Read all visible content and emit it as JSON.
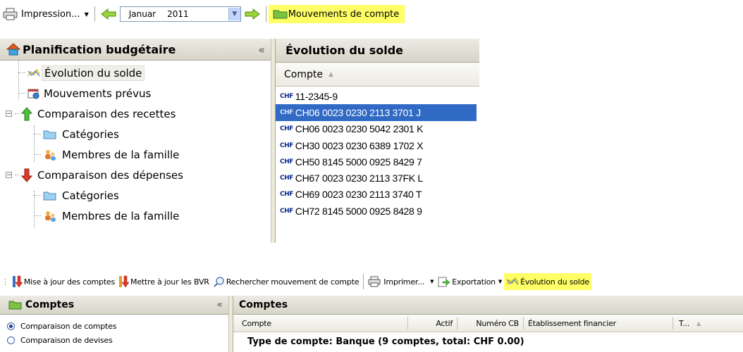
{
  "top_toolbar": {
    "print_label": "Impression...",
    "month": "Januar",
    "year": "2011",
    "account_movements_label": "Mouvements de compte"
  },
  "budget_pane": {
    "title": "Planification budgétaire",
    "items": [
      {
        "label": "Évolution du solde",
        "icon": "line-chart-icon"
      },
      {
        "label": "Mouvements prévus",
        "icon": "calendar-clock-icon"
      },
      {
        "label": "Comparaison des recettes",
        "icon": "green-up-arrow-icon"
      },
      {
        "label": "Catégories",
        "icon": "folder-icon"
      },
      {
        "label": "Membres de la famille",
        "icon": "family-icon"
      },
      {
        "label": "Comparaison des dépenses",
        "icon": "red-down-arrow-icon"
      },
      {
        "label": "Catégories",
        "icon": "folder-icon"
      },
      {
        "label": "Membres de la famille",
        "icon": "family-icon"
      }
    ]
  },
  "balance_pane": {
    "title": "Évolution du solde",
    "column_header": "Compte",
    "currency_badge": "CHF",
    "accounts": [
      "11-2345-9",
      "CH06 0023 0230 2113 3701 J",
      "CH06 0023 0230 5042 2301 K",
      "CH30 0023 0230 6389 1702 X",
      "CH50 8145 5000 0925 8429 7",
      "CH67 0023 0230 2113 37FK L",
      "CH69 0023 0230 2113 3740 T",
      "CH72 8145 5000 0925 8428 9"
    ]
  },
  "bottom_toolbar": {
    "update_accounts": "Mise à jour des comptes",
    "update_bvr": "Mettre à jour les BVR",
    "search_movement": "Rechercher mouvement de compte",
    "print": "Imprimer...",
    "export": "Exportation",
    "balance_evolution": "Évolution du solde"
  },
  "comptes_pane": {
    "title": "Comptes",
    "options": [
      {
        "label": "Comparaison de comptes",
        "selected": true
      },
      {
        "label": "Comparaison de devises",
        "selected": false
      }
    ]
  },
  "comptes_grid": {
    "title": "Comptes",
    "columns": [
      "Compte",
      "Actif",
      "Numéro CB",
      "Établissement financier",
      "T..."
    ],
    "group_row": "Type de compte: Banque (9 comptes, total: CHF 0.00)"
  },
  "colors": {
    "highlight": "#ffff66",
    "selection": "#316ac5",
    "pane_header": "#d7d4c8"
  }
}
